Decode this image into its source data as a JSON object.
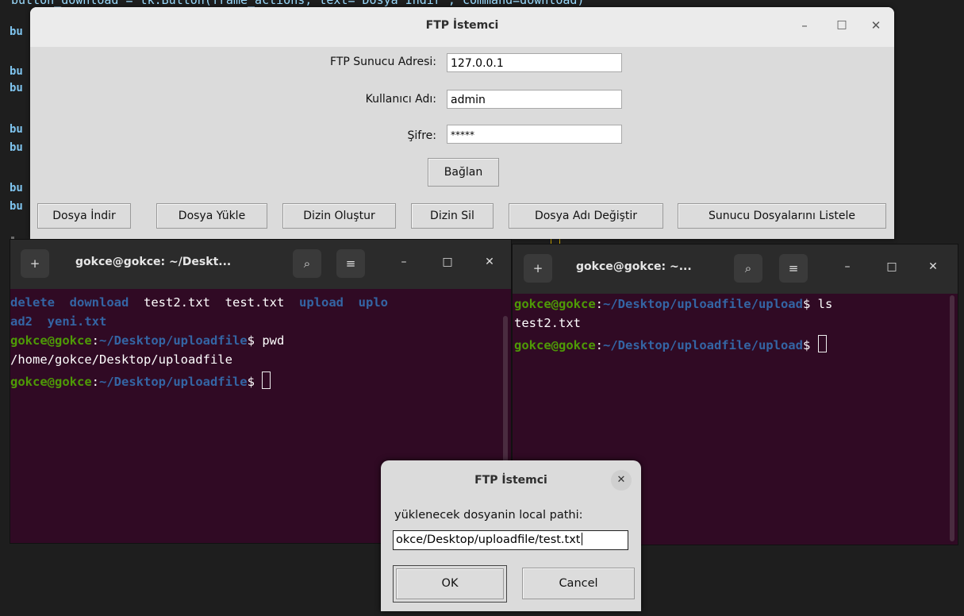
{
  "editor": {
    "top_line": "button_download = tk.Button(frame_actions, text=\"Dosya İndir\", command=download)",
    "fragments": [
      "bu",
      "bu",
      "bu",
      "bu",
      "bu",
      "bu",
      "bu"
    ]
  },
  "ftp_window": {
    "title": "FTP İstemci",
    "controls": {
      "minimize": "–",
      "maximize": "□",
      "close": "✕"
    },
    "fields": {
      "server": {
        "label": "FTP Sunucu Adresi:",
        "value": "127.0.0.1"
      },
      "username": {
        "label": "Kullanıcı Adı:",
        "value": "admin"
      },
      "password": {
        "label": "Şifre:",
        "value": "*****"
      }
    },
    "connect_label": "Bağlan",
    "actions": [
      "Dosya İndir",
      "Dosya Yükle",
      "Dizin Oluştur",
      "Dizin Sil",
      "Dosya Adı Değiştir",
      "Sunucu Dosyalarını Listele"
    ]
  },
  "terminal_left": {
    "title": "gokce@gokce: ~/Deskt...",
    "icons": {
      "new_tab": "+",
      "search": "⌕",
      "menu": "≡",
      "minimize": "–",
      "maximize": "□",
      "close": "✕"
    },
    "line1": {
      "a": "delete",
      "b": "download",
      "c": "test2.txt",
      "d": "test.txt",
      "e": "upload",
      "f": "uplo"
    },
    "line2": {
      "a": "ad2",
      "b": "yeni.txt"
    },
    "prompt_user": "gokce@gokce",
    "prompt_sep": ":",
    "prompt_path": "~/Desktop/uploadfile",
    "prompt_end": "$",
    "cmd_pwd": " pwd",
    "pwd_output": "/home/gokce/Desktop/uploadfile"
  },
  "terminal_right": {
    "title": "gokce@gokce: ~...",
    "prompt_user": "gokce@gokce",
    "prompt_sep": ":",
    "prompt_path": "~/Desktop/uploadfile/upload",
    "prompt_end": "$",
    "cmd_ls": " ls",
    "ls_output": "test2.txt"
  },
  "dialog": {
    "title": "FTP İstemci",
    "close": "✕",
    "prompt": "yüklenecek dosyanin local pathi:",
    "input_value": "okce/Desktop/uploadfile/test.txt",
    "ok_label": "OK",
    "cancel_label": "Cancel"
  }
}
